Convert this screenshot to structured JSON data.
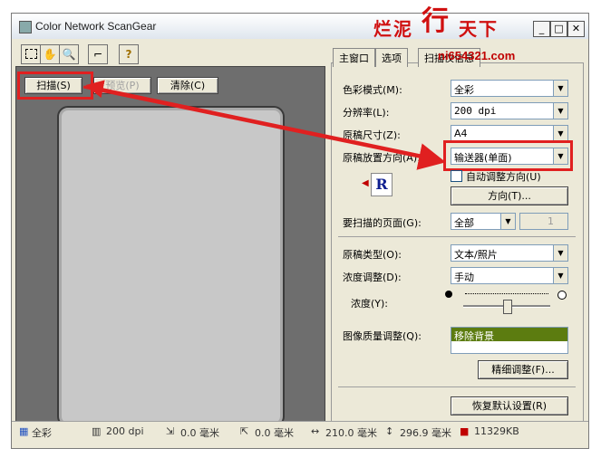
{
  "window": {
    "title": "Color Network ScanGear",
    "controls": {
      "minimize": "_",
      "maximize": "□",
      "close": "✕"
    }
  },
  "watermark": {
    "chars": [
      "烂",
      "泥",
      "行",
      "天",
      "下"
    ],
    "url": "ni654321.com"
  },
  "toolbar": {
    "icons": [
      "select-tool-icon",
      "hand-tool-icon",
      "zoom-tool-icon",
      "crop-tool-icon",
      "help-icon"
    ],
    "help_glyph": "?"
  },
  "left_buttons": {
    "scan": "扫描(S)",
    "preview": "预览(P)",
    "clear": "清除(C)"
  },
  "tabs": [
    "主窗口",
    "选项",
    "扫描仪信息"
  ],
  "settings": {
    "color_mode": {
      "label": "色彩模式(M):",
      "value": "全彩"
    },
    "resolution": {
      "label": "分辨率(L):",
      "value": "200 dpi"
    },
    "original_size": {
      "label": "原稿尺寸(Z):",
      "value": "A4"
    },
    "orientation": {
      "label": "原稿放置方向(A):",
      "value": "输送器(单面)"
    },
    "auto_orient": {
      "label": "自动调整方向(U)",
      "checked": false
    },
    "direction_button": "方向(T)...",
    "orientation_glyph": "R",
    "pages": {
      "label": "要扫描的页面(G):",
      "value": "全部",
      "spin": "1"
    },
    "original_type": {
      "label": "原稿类型(O):",
      "value": "文本/照片"
    },
    "density_adjust": {
      "label": "浓度调整(D):",
      "value": "手动"
    },
    "density": {
      "label": "浓度(Y):",
      "level": 0.5
    },
    "image_quality": {
      "label": "图像质量调整(Q):",
      "items": [
        "移除背景"
      ]
    },
    "fine_tune_button": "精细调整(F)...",
    "restore_defaults_button": "恢复默认设置(R)"
  },
  "statusbar": {
    "color": "全彩",
    "resolution": "200 dpi",
    "x": "0.0 毫米",
    "y": "0.0 毫米",
    "width": "210.0 毫米",
    "height": "296.9 毫米",
    "size": "11329KB"
  },
  "colors": {
    "accent_red": "#e02020",
    "highlight_green": "#5c7c10",
    "preview_bg": "#6e6e6e"
  }
}
